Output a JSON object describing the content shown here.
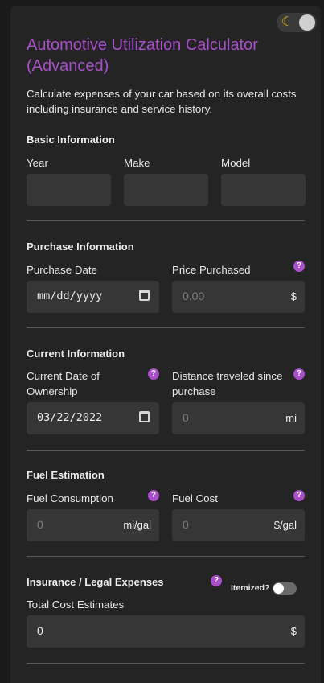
{
  "header": {
    "title": "Automotive Utilization Calculator (Advanced)",
    "description": "Calculate expenses of your car based on its overall costs including insurance and service history.",
    "theme_icon": "moon-icon"
  },
  "basic": {
    "title": "Basic Information",
    "year_label": "Year",
    "make_label": "Make",
    "model_label": "Model"
  },
  "purchase": {
    "title": "Purchase Information",
    "date_label": "Purchase Date",
    "date_value": "mm/dd/yyyy",
    "price_label": "Price Purchased",
    "price_placeholder": "0.00",
    "price_unit": "$"
  },
  "current": {
    "title": "Current Information",
    "date_label": "Current Date of Ownership",
    "date_value": "03/22/2022",
    "distance_label": "Distance traveled since purchase",
    "distance_placeholder": "0",
    "distance_unit": "mi"
  },
  "fuel": {
    "title": "Fuel Estimation",
    "consumption_label": "Fuel Consumption",
    "consumption_placeholder": "0",
    "consumption_unit": "mi/gal",
    "cost_label": "Fuel Cost",
    "cost_placeholder": "0",
    "cost_unit": "$/gal"
  },
  "insurance": {
    "title": "Insurance / Legal Expenses",
    "itemized_label": "Itemized?",
    "itemized_on": false,
    "total_label": "Total Cost Estimates",
    "total_value": "0",
    "total_unit": "$"
  },
  "help_glyph": "?",
  "colors": {
    "accent": "#a84fc9",
    "background": "#242424",
    "field": "#363636"
  }
}
